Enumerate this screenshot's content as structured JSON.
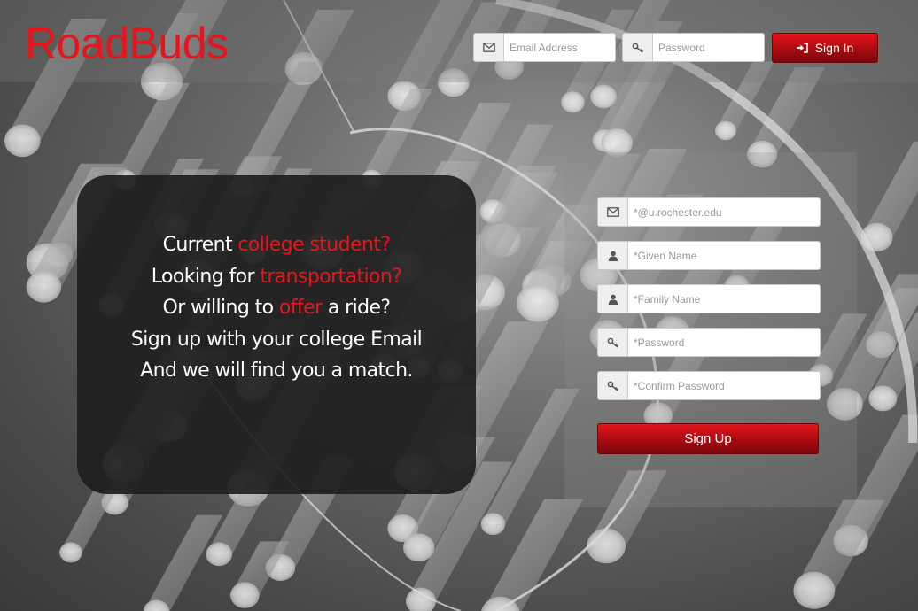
{
  "header": {
    "brand": "RoadBuds",
    "email_placeholder": "Email Address",
    "password_placeholder": "Password",
    "signin_label": "Sign In"
  },
  "message": {
    "line1_a": "Current ",
    "line1_b": "college student?",
    "line2_a": "Looking for ",
    "line2_b": "transportation?",
    "line3_a": "Or willing to ",
    "line3_b": "offer",
    "line3_c": " a ride?",
    "line4": "Sign up with your college Email",
    "line5": "And we will find you a match."
  },
  "signup": {
    "email_placeholder": "*@u.rochester.edu",
    "given_name_placeholder": "*Given Name",
    "family_name_placeholder": "*Family Name",
    "password_placeholder": "*Password",
    "confirm_password_placeholder": "*Confirm Password",
    "signup_label": "Sign Up"
  },
  "colors": {
    "brand": "#e8141b",
    "button": "#b10d13",
    "card": "#1e1e1e"
  },
  "icons": [
    "envelope-icon",
    "key-icon",
    "sign-in-icon",
    "user-icon"
  ]
}
